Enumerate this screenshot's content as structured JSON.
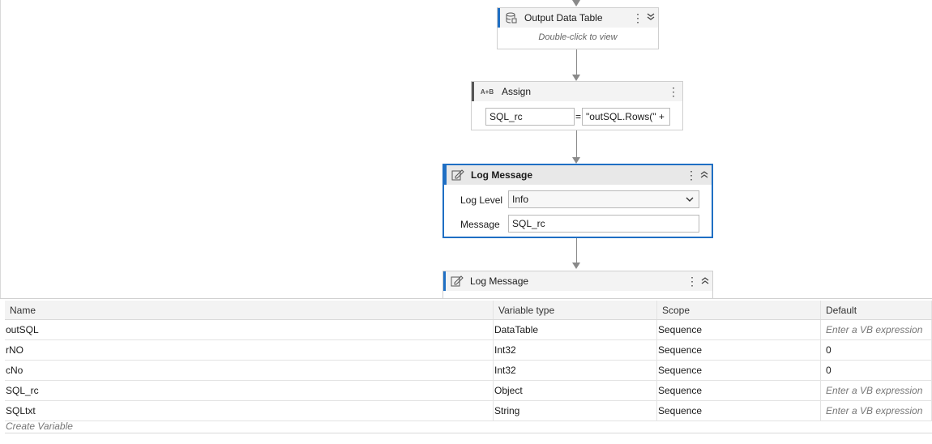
{
  "workflow": {
    "output_data_table": {
      "title": "Output Data Table",
      "hint": "Double-click to view",
      "icon": "database-icon"
    },
    "assign": {
      "title": "Assign",
      "icon_text": "A+B",
      "to_value": "SQL_rc",
      "equals": "=",
      "value": "\"outSQL.Rows(\" +"
    },
    "log_message_1": {
      "title": "Log Message",
      "icon": "log-message-icon",
      "log_level_label": "Log Level",
      "log_level_value": "Info",
      "message_label": "Message",
      "message_value": "SQL_rc"
    },
    "log_message_2": {
      "title": "Log Message",
      "icon": "log-message-icon"
    }
  },
  "variables": {
    "headers": [
      "Name",
      "Variable type",
      "Scope",
      "Default"
    ],
    "rows": [
      {
        "name": "outSQL",
        "type": "DataTable",
        "scope": "Sequence",
        "default": "Enter a VB expression",
        "placeholder": true
      },
      {
        "name": "rNO",
        "type": "Int32",
        "scope": "Sequence",
        "default": "0",
        "placeholder": false
      },
      {
        "name": "cNo",
        "type": "Int32",
        "scope": "Sequence",
        "default": "0",
        "placeholder": false
      },
      {
        "name": "SQL_rc",
        "type": "Object",
        "scope": "Sequence",
        "default": "Enter a VB expression",
        "placeholder": true
      },
      {
        "name": "SQLtxt",
        "type": "String",
        "scope": "Sequence",
        "default": "Enter a VB expression",
        "placeholder": true
      }
    ],
    "create_label": "Create Variable"
  },
  "colors": {
    "accent": "#1f6fc4",
    "connector": "#8a8a8a"
  }
}
